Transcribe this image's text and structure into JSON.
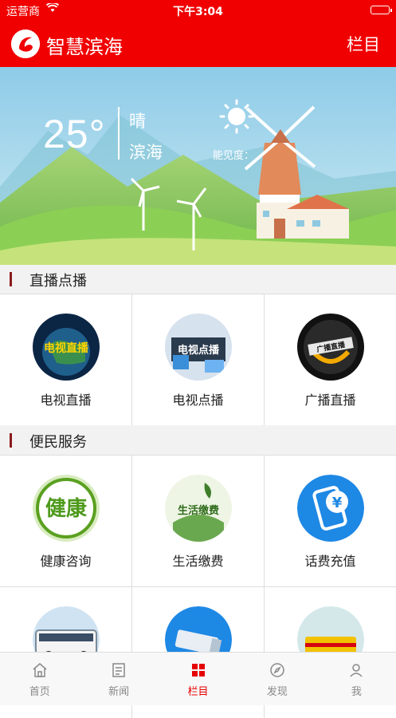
{
  "status_bar": {
    "carrier": "运营商",
    "time": "下午3:04"
  },
  "header": {
    "app_title": "智慧滨海",
    "menu_label": "栏目"
  },
  "weather": {
    "temperature": "25°",
    "condition": "晴",
    "city": "滨海",
    "visibility_label": "能见度："
  },
  "sections": [
    {
      "title": "直播点播",
      "items": [
        {
          "label": "电视直播",
          "icon_text": "电视直播",
          "icon": "tv-live-icon",
          "color": "#1a3a6a"
        },
        {
          "label": "电视点播",
          "icon_text": "电视点播",
          "icon": "tv-vod-icon",
          "color": "#3a6ea5"
        },
        {
          "label": "广播直播",
          "icon_text": "广播直播",
          "icon": "radio-live-icon",
          "color": "#1c1c1c"
        }
      ]
    },
    {
      "title": "便民服务",
      "items": [
        {
          "label": "健康咨询",
          "icon_text": "健康",
          "icon": "health-icon",
          "color": "#5aa020"
        },
        {
          "label": "生活缴费",
          "icon_text": "生活缴费",
          "icon": "bill-pay-icon",
          "color": "#6aa84f"
        },
        {
          "label": "话费充值",
          "icon_text": "¥",
          "icon": "phone-recharge-icon",
          "color": "#1e88e5"
        },
        {
          "label": "",
          "icon": "bus-icon",
          "color": "#8ab4d6"
        },
        {
          "label": "",
          "icon": "camera-icon",
          "color": "#1e88e5"
        },
        {
          "label": "",
          "icon": "express-icon",
          "color": "#f2c200"
        }
      ]
    }
  ],
  "tab_bar": [
    {
      "label": "首页",
      "icon": "home-icon"
    },
    {
      "label": "新闻",
      "icon": "news-icon"
    },
    {
      "label": "栏目",
      "icon": "columns-icon",
      "active": true
    },
    {
      "label": "发现",
      "icon": "compass-icon"
    },
    {
      "label": "我",
      "icon": "user-icon"
    }
  ]
}
